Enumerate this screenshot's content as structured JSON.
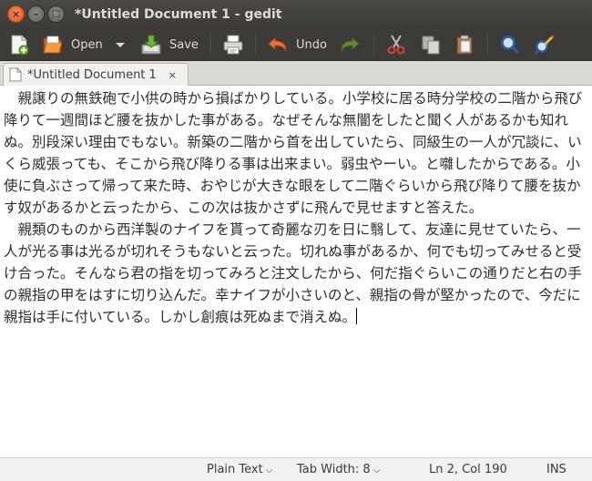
{
  "window": {
    "title": "*Untitled Document 1 - gedit",
    "buttons": {
      "close": "×",
      "minimize": "–",
      "maximize": "□"
    }
  },
  "toolbar": {
    "open_label": "Open",
    "save_label": "Save",
    "undo_label": "Undo",
    "icons": [
      "new-document-icon",
      "open-folder-icon",
      "dropdown-arrow-icon",
      "save-icon",
      "print-icon",
      "undo-icon",
      "redo-icon",
      "cut-icon",
      "copy-icon",
      "paste-icon",
      "search-icon",
      "search-replace-icon"
    ]
  },
  "tab": {
    "title": "*Untitled Document 1",
    "close": "×"
  },
  "editor": {
    "paragraphs": [
      "　親譲りの無鉄砲で小供の時から損ばかりしている。小学校に居る時分学校の二階から飛び降りて一週間ほど腰を抜かした事がある。なぜそんな無闇をしたと聞く人があるかも知れぬ。別段深い理由でもない。新築の二階から首を出していたら、同級生の一人が冗談に、いくら威張っても、そこから飛び降りる事は出来まい。弱虫やーい。と囃したからである。小使に負ぶさって帰って来た時、おやじが大きな眼をして二階ぐらいから飛び降りて腰を抜かす奴があるかと云ったから、この次は抜かさずに飛んで見せますと答えた。",
      "　親類のものから西洋製のナイフを貰って奇麗な刃を日に翳して、友達に見せていたら、一人が光る事は光るが切れそうもないと云った。切れぬ事があるか、何でも切ってみせると受け合った。そんなら君の指を切ってみろと注文したから、何だ指ぐらいこの通りだと右の手の親指の甲をはすに切り込んだ。幸ナイフが小さいのと、親指の骨が堅かったので、今だに親指は手に付いている。しかし創痕は死ぬまで消えぬ。"
    ]
  },
  "statusbar": {
    "language": "Plain Text",
    "tab_width": "Tab Width: 8",
    "position": "Ln 2, Col 190",
    "mode": "INS"
  },
  "colors": {
    "titlebar": "#3c3b37",
    "close_button": "#e0541f",
    "editor_bg": "#ffffff"
  }
}
